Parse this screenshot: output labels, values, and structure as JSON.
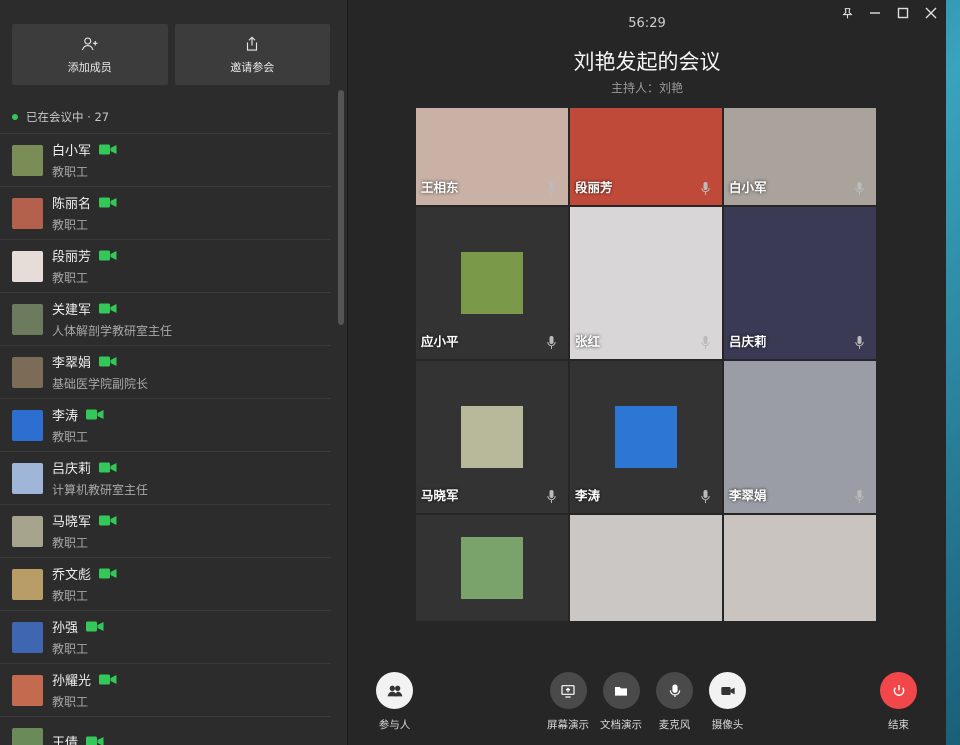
{
  "sidebar": {
    "add_member_label": "添加成员",
    "invite_label": "邀请参会",
    "status_text": "已在会议中 · 27",
    "members": [
      {
        "name": "白小军",
        "role": "教职工",
        "avatar_color": "#7a8d57"
      },
      {
        "name": "陈丽名",
        "role": "教职工",
        "avatar_color": "#b3614c"
      },
      {
        "name": "段丽芳",
        "role": "教职工",
        "avatar_color": "#e6dcd8"
      },
      {
        "name": "关建军",
        "role": "人体解剖学教研室主任",
        "avatar_color": "#6c7b5d"
      },
      {
        "name": "李翠娟",
        "role": "基础医学院副院长",
        "avatar_color": "#7b6b57"
      },
      {
        "name": "李涛",
        "role": "教职工",
        "avatar_color": "#2d6fd1"
      },
      {
        "name": "吕庆莉",
        "role": "计算机教研室主任",
        "avatar_color": "#9fb6d9"
      },
      {
        "name": "马晓军",
        "role": "教职工",
        "avatar_color": "#a6a48c"
      },
      {
        "name": "乔文彪",
        "role": "教职工",
        "avatar_color": "#b89d67"
      },
      {
        "name": "孙强",
        "role": "教职工",
        "avatar_color": "#3f66b0"
      },
      {
        "name": "孙耀光",
        "role": "教职工",
        "avatar_color": "#c46a4f"
      },
      {
        "name": "王倩",
        "role": "",
        "avatar_color": "#6b8a5a"
      }
    ]
  },
  "meeting": {
    "timer": "56:29",
    "title": "刘艳发起的会议",
    "host": "主持人：刘艳"
  },
  "tiles": [
    {
      "label": "王相东",
      "bg": "#c9b1a6",
      "thumb": ""
    },
    {
      "label": "段丽芳",
      "bg": "#c04a3a",
      "thumb": ""
    },
    {
      "label": "白小军",
      "bg": "#a9a39c",
      "thumb": ""
    },
    {
      "label": "应小平",
      "bg": "#333333",
      "thumb": "#7a9a4a"
    },
    {
      "label": "张红",
      "bg": "#d8d6d6",
      "thumb": ""
    },
    {
      "label": "吕庆莉",
      "bg": "#3a3a55",
      "thumb": ""
    },
    {
      "label": "马晓军",
      "bg": "#333333",
      "thumb": "#b8b89a"
    },
    {
      "label": "李涛",
      "bg": "#333333",
      "thumb": "#2e76d3"
    },
    {
      "label": "李翠娟",
      "bg": "#9a9ca6",
      "thumb": ""
    },
    {
      "label": "",
      "bg": "#333333",
      "thumb": "#7aa36b"
    },
    {
      "label": "",
      "bg": "#cbc7c4",
      "thumb": ""
    },
    {
      "label": "",
      "bg": "#c9c4bf",
      "thumb": ""
    }
  ],
  "controls": {
    "participants": "参与人",
    "screen_share": "屏幕演示",
    "doc_share": "文档演示",
    "mic": "麦克风",
    "camera": "摄像头",
    "end": "结束"
  },
  "colors": {
    "accent_green": "#34c759",
    "end_red": "#f2474a"
  }
}
